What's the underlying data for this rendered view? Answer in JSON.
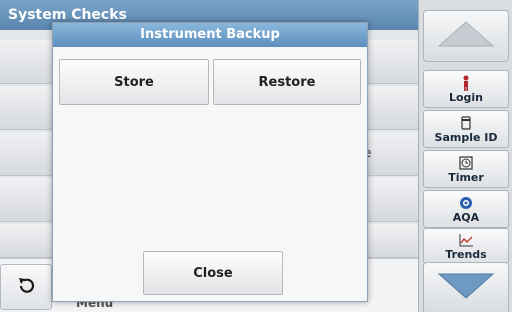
{
  "screen": {
    "title": "System Checks",
    "row_fragment": "e",
    "menu_label": "Menu"
  },
  "dialog": {
    "title": "Instrument Backup",
    "store_label": "Store",
    "restore_label": "Restore",
    "close_label": "Close"
  },
  "sidebar": {
    "login_label": "Login",
    "sample_id_label": "Sample ID",
    "timer_label": "Timer",
    "aqa_label": "AQA",
    "trends_label": "Trends"
  },
  "colors": {
    "title_bar": "#5c8ebd",
    "nav_arrow": "#6e99c2",
    "login_icon": "#b3262a",
    "aqa_icon": "#2a5fb0",
    "trends_icon": "#c0392b"
  }
}
